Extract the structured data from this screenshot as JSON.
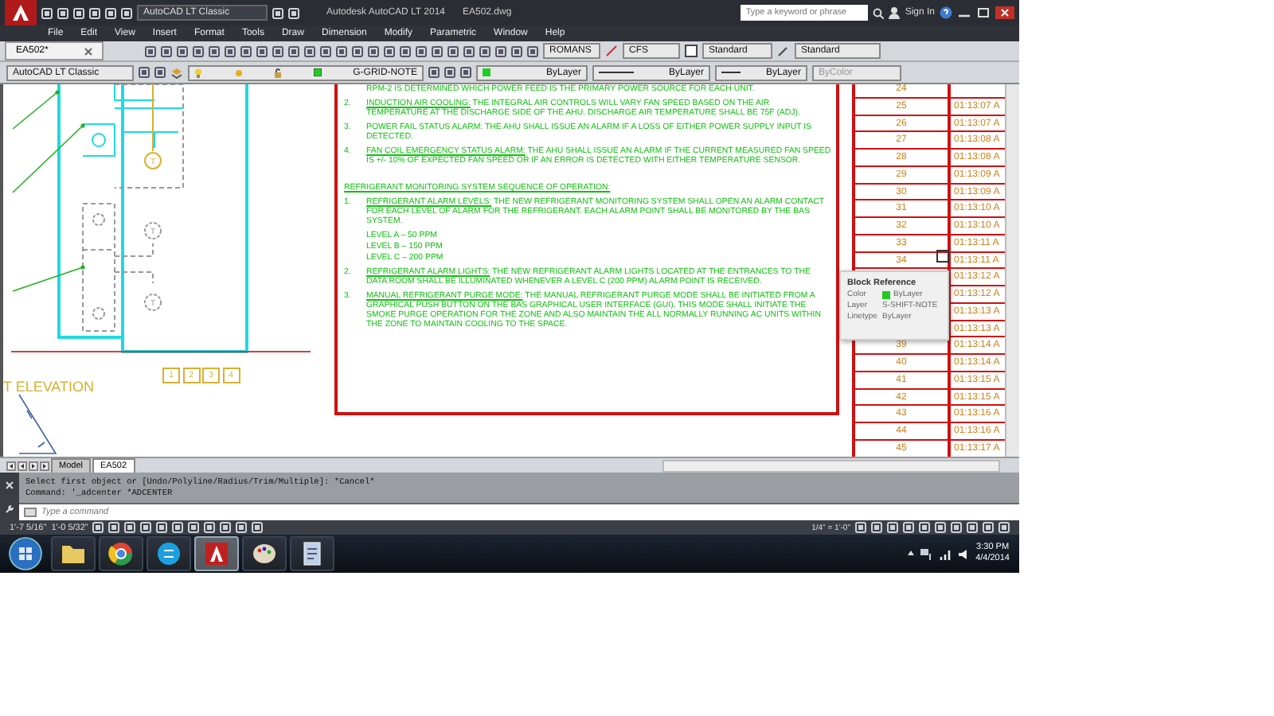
{
  "title_bar": {
    "workspace": "AutoCAD LT Classic",
    "title": "Autodesk AutoCAD LT 2014",
    "file": "EA502.dwg",
    "search": {
      "placeholder": "Type a keyword or phrase"
    },
    "sign_in": "Sign In"
  },
  "menu": [
    "File",
    "Edit",
    "View",
    "Insert",
    "Format",
    "Tools",
    "Draw",
    "Dimension",
    "Modify",
    "Parametric",
    "Window",
    "Help"
  ],
  "file_tabs": [
    {
      "label": "EA502*",
      "selected": true
    }
  ],
  "styles_toolbar": {
    "text_style": "ROMANS",
    "dim_style": "CFS",
    "table_style": "Standard",
    "multileader_style": "Standard"
  },
  "properties_toolbar": {
    "workspace": "AutoCAD LT Classic",
    "layer": "G-GRID-NOTE",
    "color_setting": "ByLayer",
    "linetype": "ByLayer",
    "lineweight": "ByLayer",
    "plot_style": "ByColor"
  },
  "drawing": {
    "elevation_label": "T ELEVATION",
    "grid_tags": [
      "1",
      "2",
      "3",
      "4"
    ],
    "sensor_tags": [
      {
        "label": "T",
        "color": "#e0b030"
      },
      {
        "label": "T",
        "color": "#9a9a9a"
      },
      {
        "label": "T",
        "color": "#9a9a9a"
      }
    ],
    "notes": [
      {
        "kind": "continuation",
        "text": "RPM-2 IS DETERMINED WHICH POWER FEED IS THE PRIMARY POWER SOURCE FOR EACH UNIT."
      },
      {
        "kind": "item",
        "number": "2.",
        "lead": "INDUCTION AIR COOLING:",
        "text": "THE INTEGRAL AIR CONTROLS WILL VARY FAN SPEED BASED ON THE AIR TEMPERATURE AT THE DISCHARGE SIDE OF THE AHU. DISCHARGE AIR TEMPERATURE SHALL BE 75F (ADJ)."
      },
      {
        "kind": "item",
        "number": "3.",
        "text": "POWER FAIL STATUS ALARM: THE AHU SHALL ISSUE AN ALARM IF A LOSS OF EITHER POWER SUPPLY INPUT IS DETECTED."
      },
      {
        "kind": "item",
        "number": "4.",
        "lead": "FAN COIL EMERGENCY STATUS ALARM:",
        "text": "THE AHU SHALL ISSUE AN ALARM IF THE CURRENT MEASURED FAN SPEED IS +/- 10% OF EXPECTED FAN SPEED OR IF AN ERROR IS DETECTED WITH EITHER TEMPERATURE SENSOR."
      },
      {
        "kind": "heading",
        "text": "REFRIGERANT MONITORING SYSTEM SEQUENCE OF OPERATION:"
      },
      {
        "kind": "item",
        "number": "1.",
        "lead": "REFRIGERANT ALARM LEVELS:",
        "text": "THE NEW REFRIGERANT MONITORING SYSTEM SHALL OPEN AN ALARM CONTACT FOR EACH LEVEL OF ALARM FOR THE REFRIGERANT. EACH ALARM POINT SHALL BE MONITORED BY THE BAS SYSTEM."
      },
      {
        "kind": "level",
        "text": "LEVEL A – 50 PPM"
      },
      {
        "kind": "level",
        "text": "LEVEL B – 150 PPM"
      },
      {
        "kind": "level",
        "text": "LEVEL C – 200 PPM"
      },
      {
        "kind": "item",
        "number": "2.",
        "lead": "REFRIGERANT ALARM LIGHTS:",
        "text": "THE NEW REFRIGERANT ALARM LIGHTS LOCATED AT THE ENTRANCES TO THE DATA ROOM SHALL BE ILLUMINATED WHENEVER A LEVEL C (200 PPM) ALARM POINT IS RECEIVED."
      },
      {
        "kind": "item",
        "number": "3.",
        "lead": "MANUAL REFRIGERANT PURGE MODE:",
        "text": "THE MANUAL REFRIGERANT PURGE MODE SHALL BE INITIATED FROM A GRAPHICAL PUSH BUTTON ON THE BAS GRAPHICAL USER INTERFACE (GUI). THIS MODE SHALL INITIATE THE SMOKE PURGE OPERATION FOR THE ZONE AND ALSO MAINTAIN THE ALL NORMALLY RUNNING AC UNITS WITHIN THE ZONE TO MAINTAIN COOLING TO THE SPACE."
      }
    ],
    "log_table": [
      {
        "number": "24"
      },
      {
        "number": "25",
        "time": "01:13:07 A"
      },
      {
        "number": "26",
        "time": "01:13:07 A"
      },
      {
        "number": "27",
        "time": "01:13:08 A"
      },
      {
        "number": "28",
        "time": "01:13:08 A"
      },
      {
        "number": "29",
        "time": "01:13:09 A"
      },
      {
        "number": "30",
        "time": "01:13:09 A"
      },
      {
        "number": "31",
        "time": "01:13:10 A"
      },
      {
        "number": "32",
        "time": "01:13:10 A"
      },
      {
        "number": "33",
        "time": "01:13:11 A"
      },
      {
        "number": "34",
        "time": "01:13:11 A"
      },
      {
        "time": "01:13:12 A"
      },
      {
        "time": "01:13:12 A"
      },
      {
        "time": "01:13:13 A"
      },
      {
        "time": "01:13:13 A"
      },
      {
        "number": "39",
        "time": "01:13:14 A"
      },
      {
        "number": "40",
        "time": "01:13:14 A"
      },
      {
        "number": "41",
        "time": "01:13:15 A"
      },
      {
        "number": "42",
        "time": "01:13:15 A"
      },
      {
        "number": "43",
        "time": "01:13:16 A"
      },
      {
        "number": "44",
        "time": "01:13:16 A"
      },
      {
        "number": "45",
        "time": "01:13:17 A"
      }
    ],
    "tooltip": {
      "title": "Block Reference",
      "rows": [
        {
          "label": "Color",
          "value": "ByLayer",
          "color": "#22cc22"
        },
        {
          "label": "Layer",
          "value": "S-SHIFT-NOTE"
        },
        {
          "label": "Linetype",
          "value": "ByLayer"
        }
      ]
    }
  },
  "layout_tabs": [
    {
      "label": "Model",
      "selected": false
    },
    {
      "label": "EA502",
      "selected": true
    }
  ],
  "command_line": {
    "history": [
      "Select first object or [Undo/Polyline/Radius/Trim/Multiple]: *Cancel*",
      "Command: '_adcenter *ADCENTER"
    ],
    "placeholder": "Type a command"
  },
  "status_bar": {
    "coordinates": [
      "1'-7 5/16\"",
      "1'-0 5/32\""
    ],
    "scale": "1/4\" = 1'-0\""
  },
  "taskbar": {
    "apps": [
      {
        "kind": "folder",
        "selected": false
      },
      {
        "kind": "browser",
        "selected": false
      },
      {
        "kind": "chat",
        "selected": false
      },
      {
        "kind": "cad",
        "selected": true
      },
      {
        "kind": "paint",
        "selected": false
      },
      {
        "kind": "document",
        "selected": false
      }
    ],
    "time": "3:30 PM",
    "date": "4/4/2014"
  }
}
